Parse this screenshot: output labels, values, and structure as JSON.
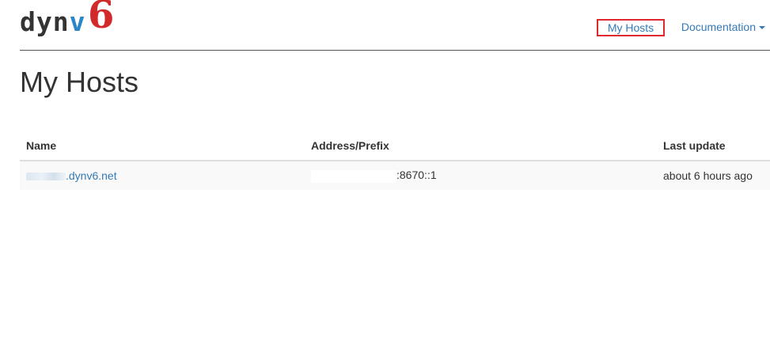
{
  "brand": {
    "name_main_prefix": "dyn",
    "name_main_v": "v",
    "name_six": "6",
    "colors": {
      "dark": "#333333",
      "blue": "#2a86c7",
      "red": "#d22a2a"
    }
  },
  "nav": {
    "my_hosts_label": "My Hosts",
    "documentation_label": "Documentation",
    "highlight_color": "#e0282f",
    "link_color": "#337ab7"
  },
  "page": {
    "title": "My Hosts"
  },
  "table": {
    "headers": {
      "name": "Name",
      "address": "Address/Prefix",
      "last_update": "Last update"
    },
    "rows": [
      {
        "name_visible": ".dynv6.net",
        "address_visible": ":8670::1",
        "last_update": "about 6 hours ago"
      }
    ]
  }
}
